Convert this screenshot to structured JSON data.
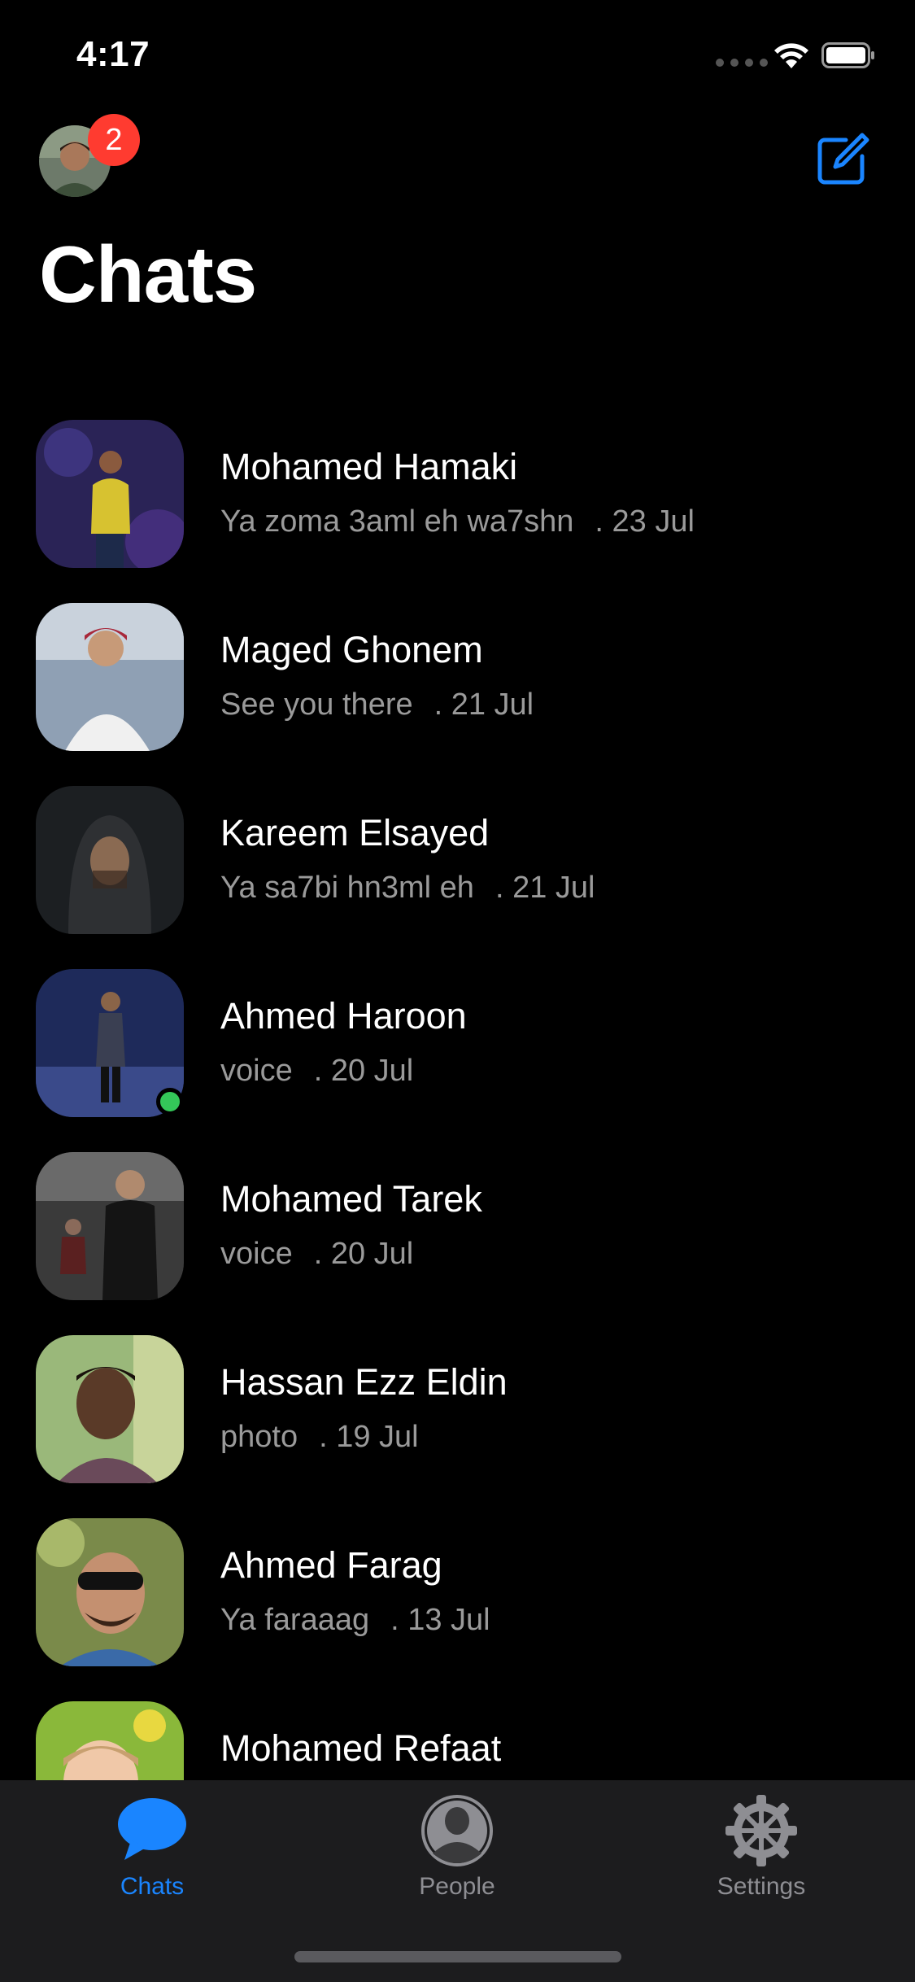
{
  "status_bar": {
    "time": "4:17"
  },
  "header": {
    "badge_count": "2",
    "title": "Chats"
  },
  "chats": [
    {
      "name": "Mohamed Hamaki",
      "preview": "Ya zoma 3aml eh wa7shn",
      "date": ". 23 Jul",
      "online": false
    },
    {
      "name": "Maged Ghonem",
      "preview": "See you there",
      "date": ". 21 Jul",
      "online": false
    },
    {
      "name": "Kareem Elsayed",
      "preview": "Ya sa7bi hn3ml eh",
      "date": ". 21 Jul",
      "online": false
    },
    {
      "name": "Ahmed Haroon",
      "preview": "voice",
      "date": ". 20 Jul",
      "online": true
    },
    {
      "name": "Mohamed Tarek",
      "preview": "voice",
      "date": ". 20 Jul",
      "online": false
    },
    {
      "name": "Hassan Ezz Eldin",
      "preview": "photo",
      "date": ". 19 Jul",
      "online": false
    },
    {
      "name": "Ahmed Farag",
      "preview": "Ya faraaag",
      "date": ". 13 Jul",
      "online": false
    },
    {
      "name": "Mohamed Refaat",
      "preview": "",
      "date": "",
      "online": false
    }
  ],
  "tabs": [
    {
      "label": "Chats",
      "icon": "chat-bubble-icon",
      "active": true
    },
    {
      "label": "People",
      "icon": "person-icon",
      "active": false
    },
    {
      "label": "Settings",
      "icon": "gear-icon",
      "active": false
    }
  ],
  "colors": {
    "accent": "#1a85ff",
    "badge": "#ff3b30",
    "online": "#34c759",
    "secondary_text": "#9a9a9a",
    "tab_bar_bg": "#1c1c1e"
  }
}
